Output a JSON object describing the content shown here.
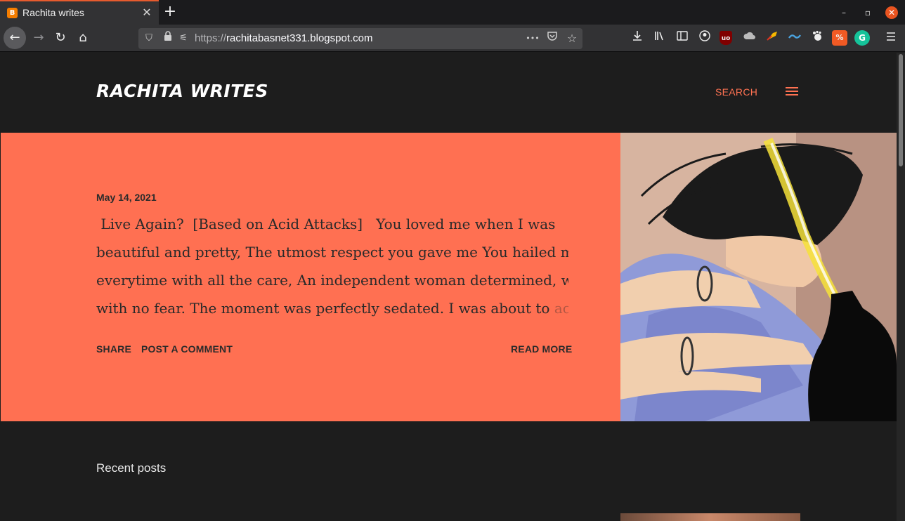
{
  "browser": {
    "tab_title": "Rachita writes",
    "url_scheme": "https://",
    "url_host": "rachitabasnet331.blogspot.com",
    "new_tab_symbol": "+",
    "tab_close_symbol": "✕",
    "window_controls": {
      "minimize": "–",
      "maximize": "▫",
      "close": "✕"
    },
    "nav": {
      "back": "←",
      "forward": "→",
      "reload": "↻",
      "home": "⌂"
    },
    "url_icons": {
      "shield": "⛉",
      "lock": "🔒",
      "permissions": "⚟",
      "more": "•••",
      "pocket": "◡",
      "bookmark": "☆"
    }
  },
  "blog": {
    "title": "RACHITA WRITES",
    "search_label": "SEARCH"
  },
  "featured_post": {
    "date": "May 14, 2021",
    "snippet_lines": [
      " Live Again?  [Based on Acid Attacks]   You loved me when I was",
      "beautiful and pretty, The utmost respect you gave me You hailed me",
      "everytime with all the care, An independent woman determined, walked",
      "with no fear. The moment was perfectly sedated. I was about to "
    ],
    "snippet_fade_text": "achiev",
    "ellipsis": "…",
    "share_label": "SHARE",
    "comment_label": "POST A COMMENT",
    "read_more_label": "READ MORE"
  },
  "recent": {
    "title": "Recent posts"
  },
  "colors": {
    "accent": "#ff7052",
    "page_bg": "#1d1d1d",
    "tab_indicator": "#e75b2e"
  }
}
